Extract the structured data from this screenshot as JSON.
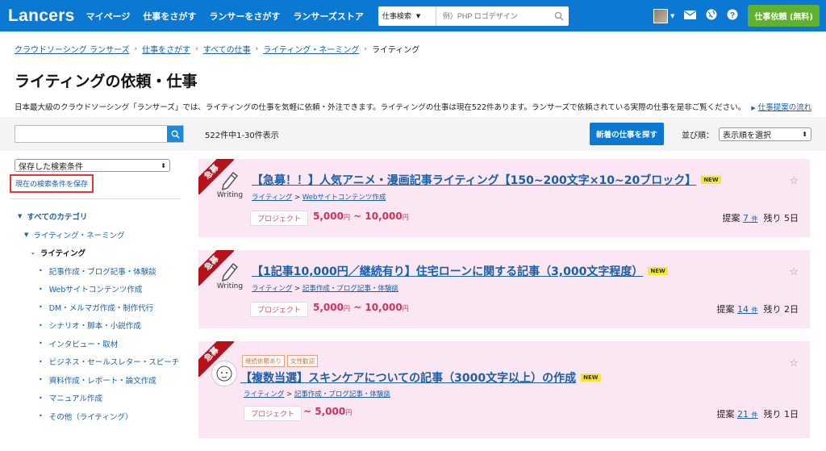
{
  "header": {
    "logo": "Lancers",
    "nav": [
      "マイページ",
      "仕事をさがす",
      "ランサーをさがす",
      "ランサーズストア"
    ],
    "search_select": "仕事検索",
    "search_placeholder": "例）PHP ロゴデザイン",
    "order_button": "仕事依頼 (無料)"
  },
  "breadcrumb": {
    "items": [
      "クラウドソーシング ランサーズ",
      "仕事をさがす",
      "すべての仕事",
      "ライティング・ネーミング"
    ],
    "current": "ライティング"
  },
  "page": {
    "title": "ライティングの依頼・仕事",
    "description": "日本最大級のクラウドソーシング「ランサーズ」では、ライティングの仕事を気軽に依頼・外注できます。ライティングの仕事は現在522件あります。ランサーズで依頼されている実際の仕事を是非ご覧ください。",
    "flow_link": "仕事提案の流れ"
  },
  "toolbar": {
    "count_text": "522件中1-30件表示",
    "new_jobs_button": "新着の仕事を探す",
    "sort_label": "並び順：",
    "sort_value": "表示順を選択"
  },
  "sidebar": {
    "saved_select": "保存した検索条件",
    "save_link": "現在の検索条件を保存",
    "tree": {
      "all": "すべてのカテゴリ",
      "parent": "ライティング・ネーミング",
      "current": "ライティング",
      "children": [
        "記事作成・ブログ記事・体験談",
        "Webサイトコンテンツ作成",
        "DM・メルマガ作成・制作代行",
        "シナリオ・脚本・小説作成",
        "インタビュー・取材",
        "ビジネス・セールスレター・スピーチ",
        "資料作成・レポート・論文作成",
        "マニュアル作成",
        "その他（ライティング）"
      ]
    }
  },
  "jobs": [
    {
      "ribbon": "急募",
      "thumb_label": "Writing",
      "title": "【急募！！】人気アニメ・漫画記事ライティング【150~200文字×10~20ブロック】",
      "new": "NEW",
      "category": "ライティング",
      "subcategory": "Webサイトコンテンツ作成",
      "type": "プロジェクト",
      "price_min": "5,000",
      "price_max": "10,000",
      "yen": "円",
      "tilde": "~",
      "proposals_label": "提案",
      "proposals": "7",
      "unit": "件",
      "remaining": "残り 5日"
    },
    {
      "ribbon": "急募",
      "thumb_label": "Writing",
      "title": "【1記事10,000円／継続有り】住宅ローンに関する記事（3,000文字程度）",
      "new": "NEW",
      "category": "ライティング",
      "subcategory": "記事作成・ブログ記事・体験談",
      "type": "プロジェクト",
      "price_min": "5,000",
      "price_max": "10,000",
      "yen": "円",
      "tilde": "~",
      "proposals_label": "提案",
      "proposals": "14",
      "unit": "件",
      "remaining": "残り 2日"
    },
    {
      "ribbon": "急募",
      "tags": [
        "継続依頼あり",
        "女性歓迎"
      ],
      "title": "【複数当選】スキンケアについての記事（3000文字以上）の作成",
      "new": "NEW",
      "category": "ライティング",
      "subcategory": "記事作成・ブログ記事・体験談",
      "type": "プロジェクト",
      "price_max": "5,000",
      "yen": "円",
      "tilde": "~",
      "proposals_label": "提案",
      "proposals": "21",
      "unit": "件",
      "remaining": "残り 1日"
    }
  ],
  "colors": {
    "brand": "#0b78d2",
    "order_button": "#5fb12f",
    "card_bg": "#fbe6f3",
    "ribbon": "#b5121b",
    "price": "#d0325a",
    "link": "#1a5fab"
  }
}
